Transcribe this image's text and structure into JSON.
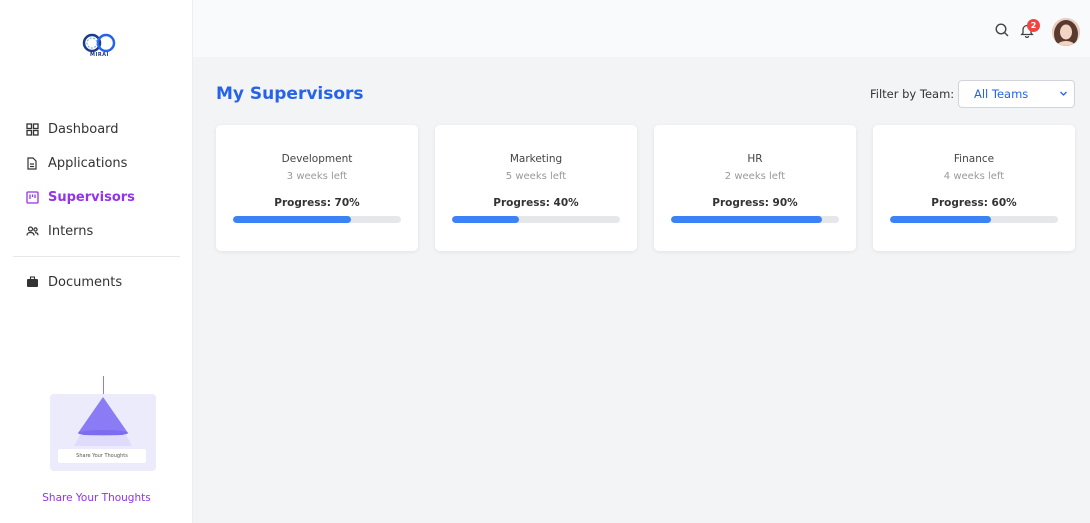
{
  "brand": {
    "logo_text": "MIRAI"
  },
  "sidebar": {
    "items": [
      {
        "label": "Dashboard",
        "icon": "grid-icon",
        "active": false
      },
      {
        "label": "Applications",
        "icon": "file-icon",
        "active": false
      },
      {
        "label": "Supervisors",
        "icon": "board-icon",
        "active": true
      },
      {
        "label": "Interns",
        "icon": "users-icon",
        "active": false
      }
    ],
    "secondary_items": [
      {
        "label": "Documents",
        "icon": "briefcase-icon",
        "active": false
      }
    ],
    "promo": {
      "button_label": "Share Your Thoughts",
      "link_label": "Share Your Thoughts"
    }
  },
  "topbar": {
    "notification_count": "2",
    "icons": [
      "search-icon",
      "bell-icon",
      "avatar"
    ]
  },
  "main": {
    "title": "My Supervisors",
    "filter": {
      "label": "Filter by Team:",
      "selected": "All Teams"
    },
    "cards": [
      {
        "team": "Development",
        "time_left": "3 weeks left",
        "progress_label": "Progress: 70%",
        "progress": 70
      },
      {
        "team": "Marketing",
        "time_left": "5 weeks left",
        "progress_label": "Progress: 40%",
        "progress": 40
      },
      {
        "team": "HR",
        "time_left": "2 weeks left",
        "progress_label": "Progress: 90%",
        "progress": 90
      },
      {
        "team": "Finance",
        "time_left": "4 weeks left",
        "progress_label": "Progress: 60%",
        "progress": 60
      }
    ]
  },
  "colors": {
    "accent": "#9333ea",
    "primary": "#2563eb",
    "progress": "#3b82f6",
    "badge": "#ef4444"
  }
}
